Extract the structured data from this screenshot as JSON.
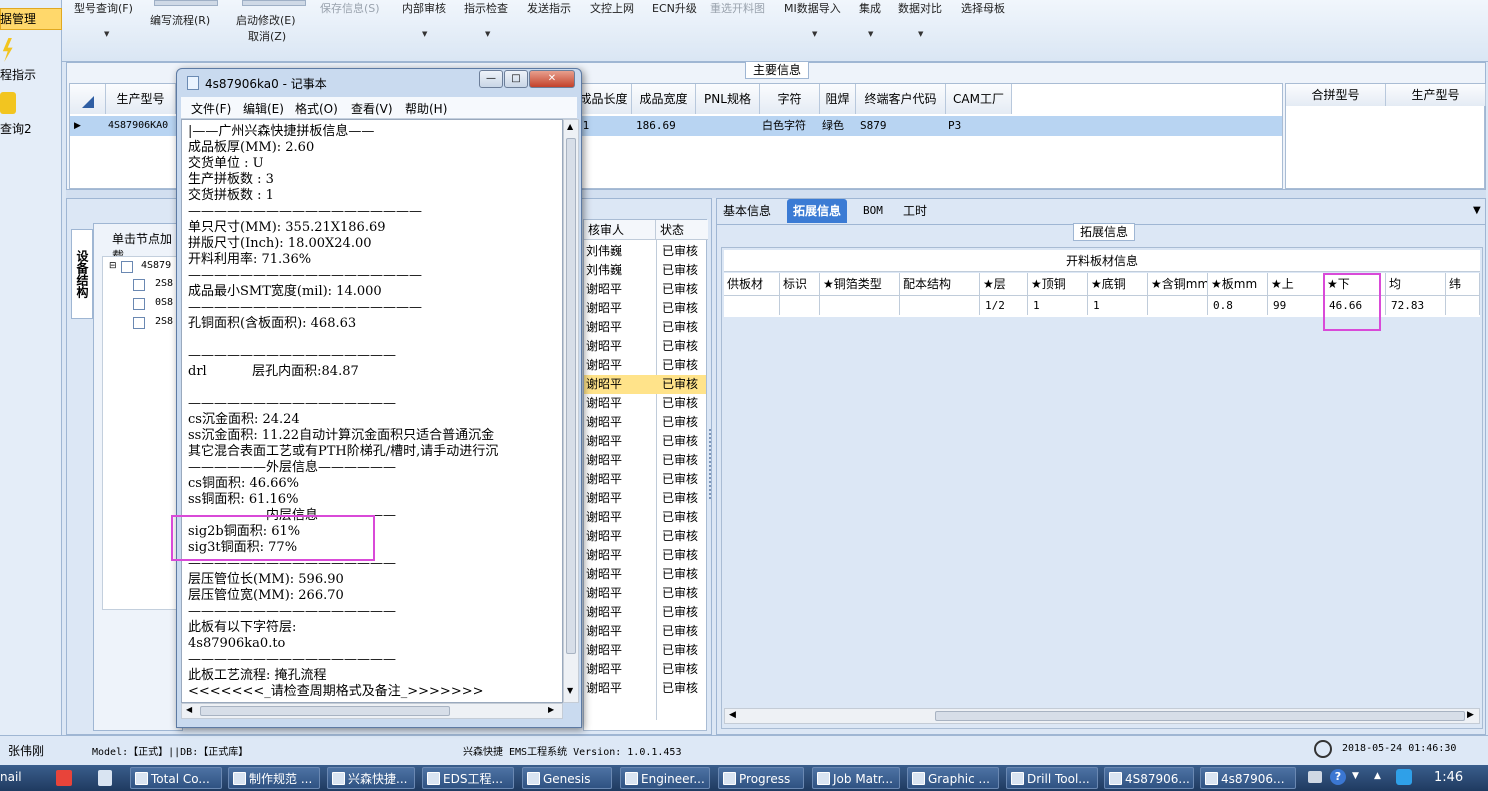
{
  "left_strip": {
    "items": [
      "据管理",
      "程指示",
      "查询2"
    ]
  },
  "ribbon": {
    "items": [
      {
        "label": "型号查询(F)",
        "disabled": false
      },
      {
        "label": "编写流程(R)",
        "disabled": false
      },
      {
        "label": "启动修改(E)",
        "disabled": false
      },
      {
        "label": "取消(Z)",
        "disabled": false
      },
      {
        "label": "保存信息(S)",
        "disabled": true
      },
      {
        "label": "内部审核",
        "disabled": false
      },
      {
        "label": "指示检查",
        "disabled": false
      },
      {
        "label": "发送指示",
        "disabled": false
      },
      {
        "label": "文控上网",
        "disabled": false
      },
      {
        "label": "ECN升级",
        "disabled": false
      },
      {
        "label": "重选开料图",
        "disabled": true
      },
      {
        "label": "MI数据导入",
        "disabled": false
      },
      {
        "label": "集成",
        "disabled": false
      },
      {
        "label": "数据对比",
        "disabled": false
      },
      {
        "label": "选择母板",
        "disabled": false
      }
    ]
  },
  "main_info": {
    "title": "主要信息",
    "columns": [
      "生产型号",
      "成品长度",
      "成品宽度",
      "PNL规格",
      "字符",
      "阻焊",
      "终端客户代码",
      "CAM工厂"
    ],
    "row": [
      "4S87906KA0",
      "21",
      "186.69",
      "",
      "白色字符",
      "绿色",
      "S879",
      "P3"
    ],
    "side_columns": [
      "合拼型号",
      "生产型号"
    ]
  },
  "left_panel": {
    "vertical_tab": "设备结构",
    "tree_header": "单击节点加载",
    "tree_root": "4S879",
    "tree_children": [
      "2S8",
      "0S8",
      "2S8"
    ],
    "review_columns": [
      "核审人",
      "状态"
    ],
    "reviews": [
      [
        "刘伟巍",
        "已审核"
      ],
      [
        "刘伟巍",
        "已审核"
      ],
      [
        "谢昭平",
        "已审核"
      ],
      [
        "谢昭平",
        "已审核"
      ],
      [
        "谢昭平",
        "已审核"
      ],
      [
        "谢昭平",
        "已审核"
      ],
      [
        "谢昭平",
        "已审核"
      ],
      [
        "谢昭平",
        "已审核"
      ],
      [
        "谢昭平",
        "已审核"
      ],
      [
        "谢昭平",
        "已审核"
      ],
      [
        "谢昭平",
        "已审核"
      ],
      [
        "谢昭平",
        "已审核"
      ],
      [
        "谢昭平",
        "已审核"
      ],
      [
        "谢昭平",
        "已审核"
      ],
      [
        "谢昭平",
        "已审核"
      ],
      [
        "谢昭平",
        "已审核"
      ],
      [
        "谢昭平",
        "已审核"
      ],
      [
        "谢昭平",
        "已审核"
      ],
      [
        "谢昭平",
        "已审核"
      ],
      [
        "谢昭平",
        "已审核"
      ],
      [
        "谢昭平",
        "已审核"
      ],
      [
        "谢昭平",
        "已审核"
      ],
      [
        "谢昭平",
        "已审核"
      ],
      [
        "谢昭平",
        "已审核"
      ]
    ]
  },
  "right_panel": {
    "tabs": [
      "基本信息",
      "拓展信息",
      "BOM",
      "工时"
    ],
    "group_title": "拓展信息",
    "grid_title": "开料板材信息",
    "columns": [
      "供板材",
      "标识",
      "★铜箔类型",
      "配本结构",
      "★层",
      "★顶铜",
      "★底铜",
      "★含铜mm",
      "★板mm",
      "★上",
      "★下",
      "均",
      "纬"
    ],
    "row": [
      "",
      "",
      "",
      "",
      "1/2",
      "1",
      "1",
      "",
      "0.8",
      "99",
      "46.66",
      "72.83",
      ""
    ]
  },
  "notepad": {
    "title": "4s87906ka0 - 记事本",
    "menu": [
      "文件(F)",
      "编辑(E)",
      "格式(O)",
      "查看(V)",
      "帮助(H)"
    ],
    "lines": [
      "|——广州兴森快捷拼板信息——",
      "成品板厚(MM): 2.60",
      "交货单位 : U",
      "生产拼板数 : 3",
      "交货拼板数 : 1",
      "——————————————————",
      "单只尺寸(MM): 355.21X186.69",
      "拼版尺寸(Inch): 18.00X24.00",
      "开料利用率: 71.36%",
      "——————————————————",
      "成品最小SMT宽度(mil): 14.000",
      "——————————————————",
      "孔铜面积(含板面积): 468.63",
      "",
      "————————————————",
      "drl           层孔内面积:84.87",
      "",
      "————————————————",
      "cs沉金面积: 24.24",
      "ss沉金面积: 11.22自动计算沉金面积只适合普通沉金",
      "其它混合表面工艺或有PTH阶梯孔/槽时,请手动进行沉",
      "——————外层信息——————",
      "cs铜面积: 46.66%",
      "ss铜面积: 61.16%",
      "——————内层信息——————",
      "sig2b铜面积: 61%",
      "sig3t铜面积: 77%",
      "————————————————",
      "层压管位长(MM): 596.90",
      "层压管位宽(MM): 266.70",
      "————————————————",
      "此板有以下字符层:",
      "4s87906ka0.to",
      "————————————————",
      "此板工艺流程: 掩孔流程",
      "<<<<<<<_请检查周期格式及备注_>>>>>>>"
    ]
  },
  "status_bar": {
    "user": "张伟刚",
    "model": "Model:【正式】||DB:【正式库】",
    "app": "兴森快捷 EMS工程系统 Version: 1.0.1.453",
    "datetime": "2018-05-24 01:46:30"
  },
  "taskbar": {
    "left_label": "nail",
    "items": [
      "Total Co...",
      "制作规范 ...",
      "兴森快捷...",
      "EDS工程...",
      "Genesis",
      "Engineer...",
      "Progress",
      "Job Matr...",
      "Graphic ...",
      "Drill Tool...",
      "4S87906...",
      "4s87906..."
    ],
    "clock": "1:46"
  },
  "colors": {
    "highlight": "#d94ad8",
    "selected_row": "#b8d4f2",
    "selected_tab": "#3b7bd4",
    "review_highlight": "#ffe38a"
  }
}
